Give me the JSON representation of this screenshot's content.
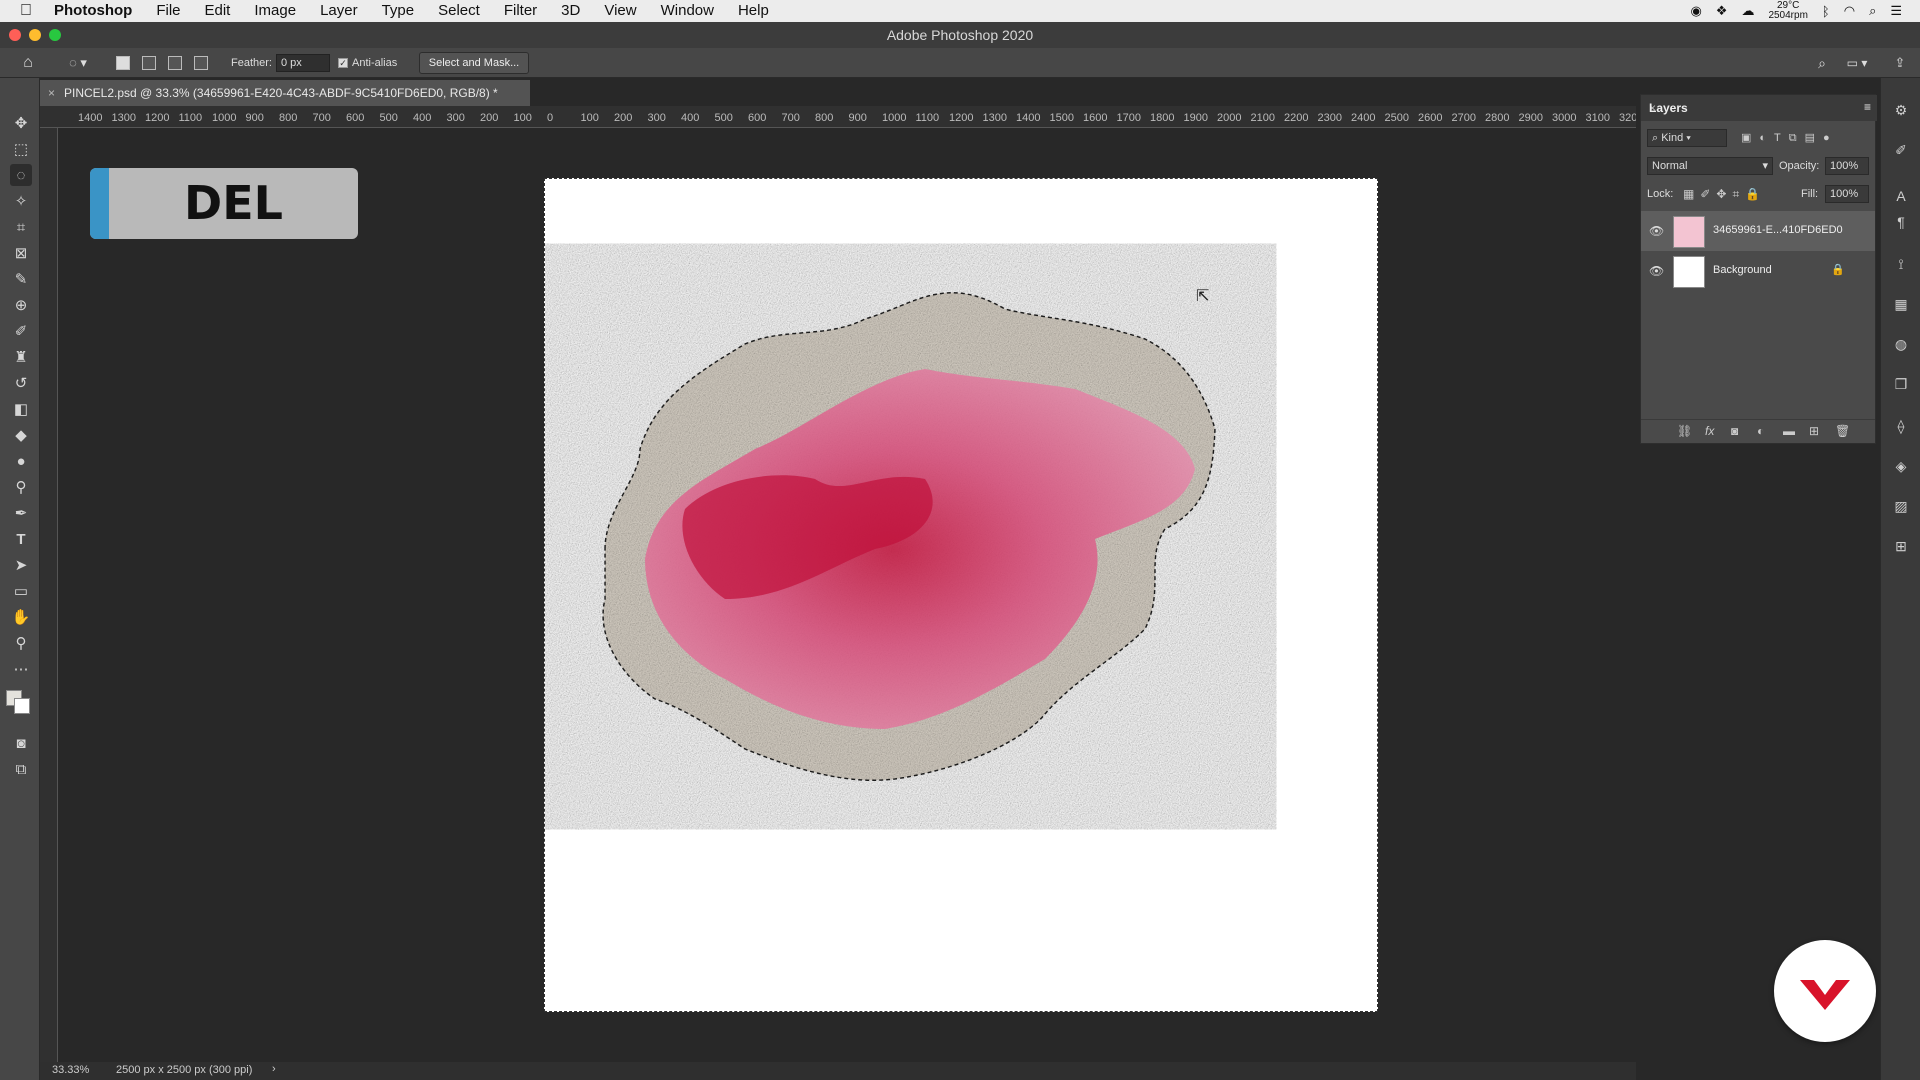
{
  "menubar": {
    "app_name": "Photoshop",
    "items": [
      "File",
      "Edit",
      "Image",
      "Layer",
      "Type",
      "Select",
      "Filter",
      "3D",
      "View",
      "Window",
      "Help"
    ],
    "weather": "29°C",
    "rpm": "2504rpm"
  },
  "window": {
    "title": "Adobe Photoshop 2020"
  },
  "options": {
    "feather_label": "Feather:",
    "feather_value": "0 px",
    "antialias_label": "Anti-alias",
    "antialias_checked": true,
    "select_mask_label": "Select and Mask..."
  },
  "document": {
    "tab_title": "PINCEL2.psd @ 33.3% (34659961-E420-4C43-ABDF-9C5410FD6ED0, RGB/8) *",
    "overlay_label": "DEL"
  },
  "ruler": {
    "labels": [
      "1400",
      "1300",
      "1200",
      "1100",
      "1000",
      "900",
      "800",
      "700",
      "600",
      "500",
      "400",
      "300",
      "200",
      "100",
      "0",
      "100",
      "200",
      "300",
      "400",
      "500",
      "600",
      "700",
      "800",
      "900",
      "1000",
      "1100",
      "1200",
      "1300",
      "1400",
      "1500",
      "1600",
      "1700",
      "1800",
      "1900",
      "2000",
      "2100",
      "2200",
      "2300",
      "2400",
      "2500",
      "2600",
      "2700",
      "2800",
      "2900",
      "3000",
      "3100",
      "320"
    ]
  },
  "status": {
    "zoom": "33.33%",
    "doc_size": "2500 px x 2500 px (300 ppi)",
    "arrow": "›"
  },
  "layers_panel": {
    "title": "Layers",
    "filter_kind": "Kind",
    "blend_mode": "Normal",
    "opacity_label": "Opacity:",
    "opacity_value": "100%",
    "lock_label": "Lock:",
    "fill_label": "Fill:",
    "fill_value": "100%",
    "layers": [
      {
        "name": "34659961-E...410FD6ED0",
        "visible": true,
        "selected": true
      },
      {
        "name": "Background",
        "visible": true,
        "locked": true
      }
    ]
  },
  "colors": {
    "accent_blue": "#3a94c6",
    "brand_red": "#d8132a",
    "panel_bg": "#4a4a4a",
    "canvas_bg": "#282828"
  }
}
